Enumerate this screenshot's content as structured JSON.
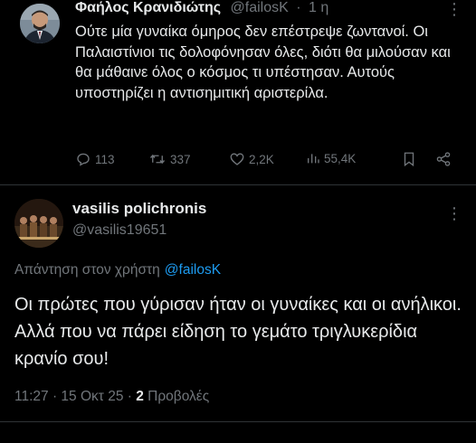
{
  "tweet": {
    "author_name": "Φαήλος Κρανιδιώτης",
    "author_handle": "@failosK",
    "separator": "·",
    "time": "1 η",
    "more_icon": "⋮",
    "text": "Ούτε μία γυναίκα όμηρος δεν επέστρεψε ζωντανοί. Οι Παλαιστίνιοι τις δολοφόνησαν όλες, διότι θα μιλούσαν και θα μάθαινε όλος ο κόσμος τι υπέστησαν. Αυτούς υποστηρίζει η αντισημιτική αριστερίλα.",
    "actions": {
      "replies": "113",
      "retweets": "337",
      "likes": "2,2K",
      "views": "55,4K"
    }
  },
  "reply": {
    "author_name": "vasilis polichronis",
    "author_handle": "@vasilis19651",
    "more_icon": "⋮",
    "reply_label": "Απάντηση στον χρήστη",
    "reply_mention": "@failosK",
    "text": "Οι πρώτες που γύρισαν ήταν οι γυναίκες και οι ανήλικοι. Αλλά που να πάρει είδηση το γεμάτο τριγλυκερίδια κρανίο σου!",
    "timestamp": "11:27 · 15 Οκτ 25 ·",
    "views_count": "2",
    "views_label": "Προβολές"
  },
  "colors": {
    "background": "#000000",
    "text": "#e7e9ea",
    "muted": "#71767b",
    "link": "#1d9bf0",
    "divider": "#2f3336"
  }
}
